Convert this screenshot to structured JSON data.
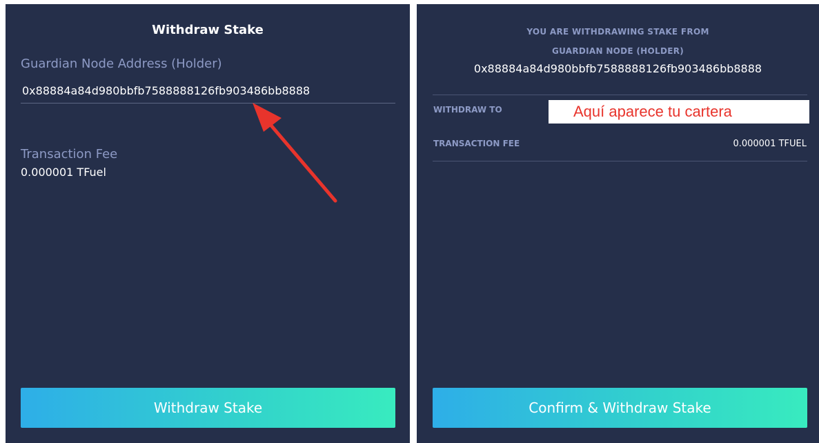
{
  "left_panel": {
    "title": "Withdraw Stake",
    "address_label": "Guardian Node Address (Holder)",
    "address_value": "0x88884a84d980bbfb7588888126fb903486bb8888",
    "fee_label": "Transaction Fee",
    "fee_value": "0.000001 TFuel",
    "button_label": "Withdraw Stake",
    "arrow_color": "#e8342c"
  },
  "right_panel": {
    "notice_line1": "YOU ARE WITHDRAWING STAKE FROM",
    "notice_line2": "GUARDIAN NODE (HOLDER)",
    "node_address": "0x88884a84d980bbfb7588888126fb903486bb8888",
    "withdraw_to_label": "WITHDRAW TO",
    "wallet_placeholder_text": "Aquí aparece tu cartera",
    "fee_label": "TRANSACTION FEE",
    "fee_value": "0.000001 TFUEL",
    "button_label": "Confirm & Withdraw Stake"
  },
  "colors": {
    "panel_background": "#252f4a",
    "label_color": "#8d9ac5",
    "gradient_start": "#2eaee8",
    "gradient_end": "#38ebbf",
    "annotation_red": "#e8342c"
  }
}
